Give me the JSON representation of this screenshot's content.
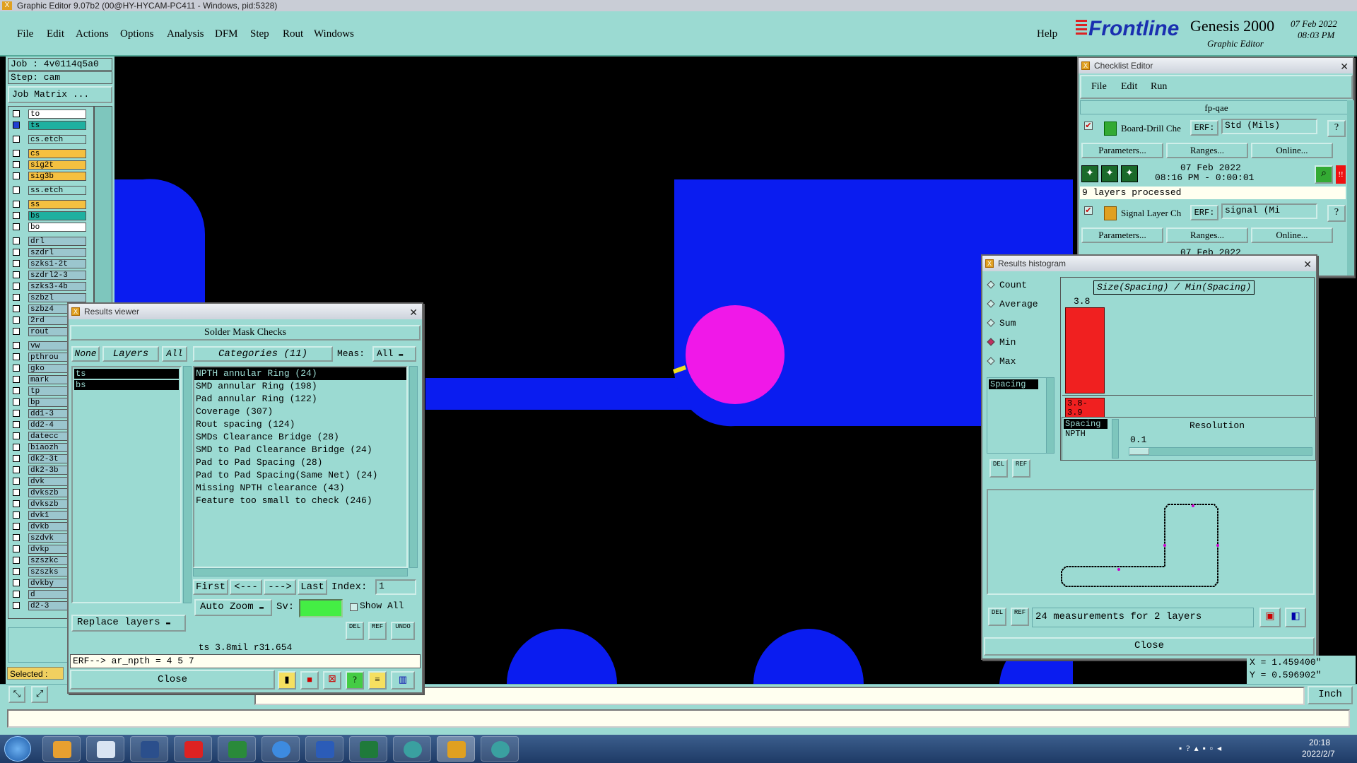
{
  "app": {
    "title": "Graphic Editor 9.07b2 (00@HY-HYCAM-PC411 - Windows, pid:5328)"
  },
  "menu": {
    "items": [
      "File",
      "Edit",
      "Actions",
      "Options",
      "Analysis",
      "DFM",
      "Step",
      "Rout",
      "Windows"
    ],
    "help": "Help"
  },
  "brand": {
    "logo": "Frontline",
    "product": "Genesis 2000",
    "subtitle": "Graphic Editor",
    "date": "07 Feb 2022",
    "time": "08:03 PM"
  },
  "job": {
    "job_label": "Job : 4v0114q5a0",
    "step_label": "Step: cam",
    "matrix_button": "Job Matrix ..."
  },
  "layers": [
    "to",
    "ts",
    "cs.etch",
    "cs",
    "sig2t",
    "sig3b",
    "ss.etch",
    "ss",
    "bs",
    "bo",
    "drl",
    "szdrl",
    "szks1-2t",
    "szdrl2-3",
    "szks3-4b",
    "szbzl",
    "szbz4",
    "2rd",
    "rout",
    "vw",
    "pthrou",
    "gko",
    "mark",
    "tp",
    "bp",
    "dd1-3",
    "dd2-4",
    "datecc",
    "biaozh",
    "dk2-3t",
    "dk2-3b",
    "dvk",
    "dvkszb",
    "dvkszb",
    "dvk1",
    "dvkb",
    "szdvk",
    "dvkp",
    "szszkc",
    "szszks",
    "dvkby",
    "d",
    "d2-3"
  ],
  "selected_label": "Selected :",
  "results_viewer": {
    "title": "Results viewer",
    "header": "Solder Mask Checks",
    "none": "None",
    "layers_tab": "Layers",
    "all": "All",
    "categories_tab": "Categories (11)",
    "meas_label": "Meas:",
    "meas_value": "All",
    "layer_list": [
      "ts",
      "bs"
    ],
    "categories": [
      "NPTH annular Ring (24)",
      "SMD annular Ring (198)",
      "Pad annular Ring (122)",
      "Coverage (307)",
      "Rout spacing (124)",
      "SMDs Clearance Bridge (28)",
      "SMD to Pad Clearance Bridge (24)",
      "Pad to Pad Spacing (28)",
      "Pad to Pad Spacing(Same Net) (24)",
      "Missing NPTH clearance (43)",
      "Feature too small to check (246)"
    ],
    "first": "First",
    "prev": "<---",
    "next": "--->",
    "last": "Last",
    "index_label": "Index:",
    "index_value": "1",
    "auto_zoom": "Auto Zoom",
    "sv": "Sv:",
    "show_all": "Show All",
    "replace_layers": "Replace layers",
    "del": "DEL",
    "ref": "REF",
    "undo": "UNDO",
    "status": "ts 3.8mil  r31.654",
    "erf": "ERF--> ar_npth = 4 5 7",
    "close": "Close"
  },
  "checklist": {
    "title": "Checklist Editor",
    "menu": [
      "File",
      "Edit",
      "Run"
    ],
    "name": "fp-qae",
    "item1": {
      "name": "Board-Drill Che",
      "erf": "ERF:",
      "erf_value": "Std (Mils)",
      "params": "Parameters...",
      "ranges": "Ranges...",
      "online": "Online...",
      "date": "07 Feb 2022",
      "time": "08:16 PM - 0:00:01",
      "status": "9 layers processed"
    },
    "item2": {
      "name": "Signal Layer Ch",
      "erf": "ERF:",
      "erf_value": "signal (Mi",
      "params": "Parameters...",
      "ranges": "Ranges...",
      "online": "Online...",
      "date": "07 Feb 2022"
    }
  },
  "histogram": {
    "title": "Results histogram",
    "options": [
      "Count",
      "Average",
      "Sum",
      "Min",
      "Max"
    ],
    "selected": "Min",
    "chart_title": "Size(Spacing) / Min(Spacing)",
    "bar_value": "3.8",
    "bar_label": "3.8-3.9",
    "list": [
      "Spacing"
    ],
    "meas_list": [
      "Spacing",
      "NPTH"
    ],
    "resolution_label": "Resolution",
    "resolution_value": "0.1",
    "measurements": "24 measurements for 2 layers",
    "close": "Close",
    "del": "DEL",
    "ref": "REF"
  },
  "coords": {
    "x": "X = 1.459400\"",
    "y": "Y = 0.596902\"",
    "unit": "Inch"
  },
  "taskbar": {
    "time": "20:18",
    "date": "2022/2/7"
  }
}
